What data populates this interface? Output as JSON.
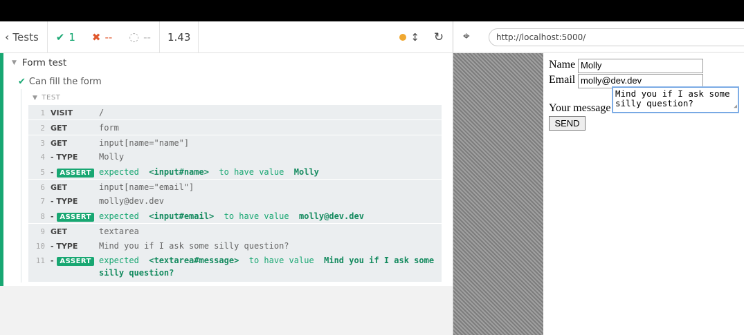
{
  "toolbar": {
    "tests_label": "Tests",
    "passed": "1",
    "failed": "--",
    "pending": "--",
    "duration": "1.43"
  },
  "suite": {
    "title": "Form test",
    "test_title": "Can fill the form",
    "hook_title": "TEST"
  },
  "commands": [
    {
      "num": "1",
      "name": "VISIT",
      "msg": "/"
    },
    {
      "num": "2",
      "name": "GET",
      "msg": "form"
    },
    {
      "num": "3",
      "name": "GET",
      "msg": "input[name=\"name\"]"
    },
    {
      "num": "4",
      "name": "- TYPE",
      "msg": "Molly"
    },
    {
      "num": "5",
      "name": "ASSERT",
      "expected": "expected",
      "subject": "<input#name>",
      "verb": "to have value",
      "value": "Molly"
    },
    {
      "num": "6",
      "name": "GET",
      "msg": "input[name=\"email\"]"
    },
    {
      "num": "7",
      "name": "- TYPE",
      "msg": "molly@dev.dev"
    },
    {
      "num": "8",
      "name": "ASSERT",
      "expected": "expected",
      "subject": "<input#email>",
      "verb": "to have value",
      "value": "molly@dev.dev"
    },
    {
      "num": "9",
      "name": "GET",
      "msg": "textarea"
    },
    {
      "num": "10",
      "name": "- TYPE",
      "msg": "Mind you if I ask some silly question?"
    },
    {
      "num": "11",
      "name": "ASSERT",
      "expected": "expected",
      "subject": "<textarea#message>",
      "verb": "to have value",
      "value": "Mind you if I ask some silly question?"
    }
  ],
  "app": {
    "url": "http://localhost:5000/",
    "name_label": "Name",
    "name_value": "Molly",
    "email_label": "Email",
    "email_value": "molly@dev.dev",
    "message_label": "Your message",
    "message_value": "Mind you if I ask some silly question?",
    "send_label": "SEND"
  },
  "colors": {
    "pass": "#18a772",
    "fail": "#e0572c",
    "running_dot": "#f0a830"
  }
}
